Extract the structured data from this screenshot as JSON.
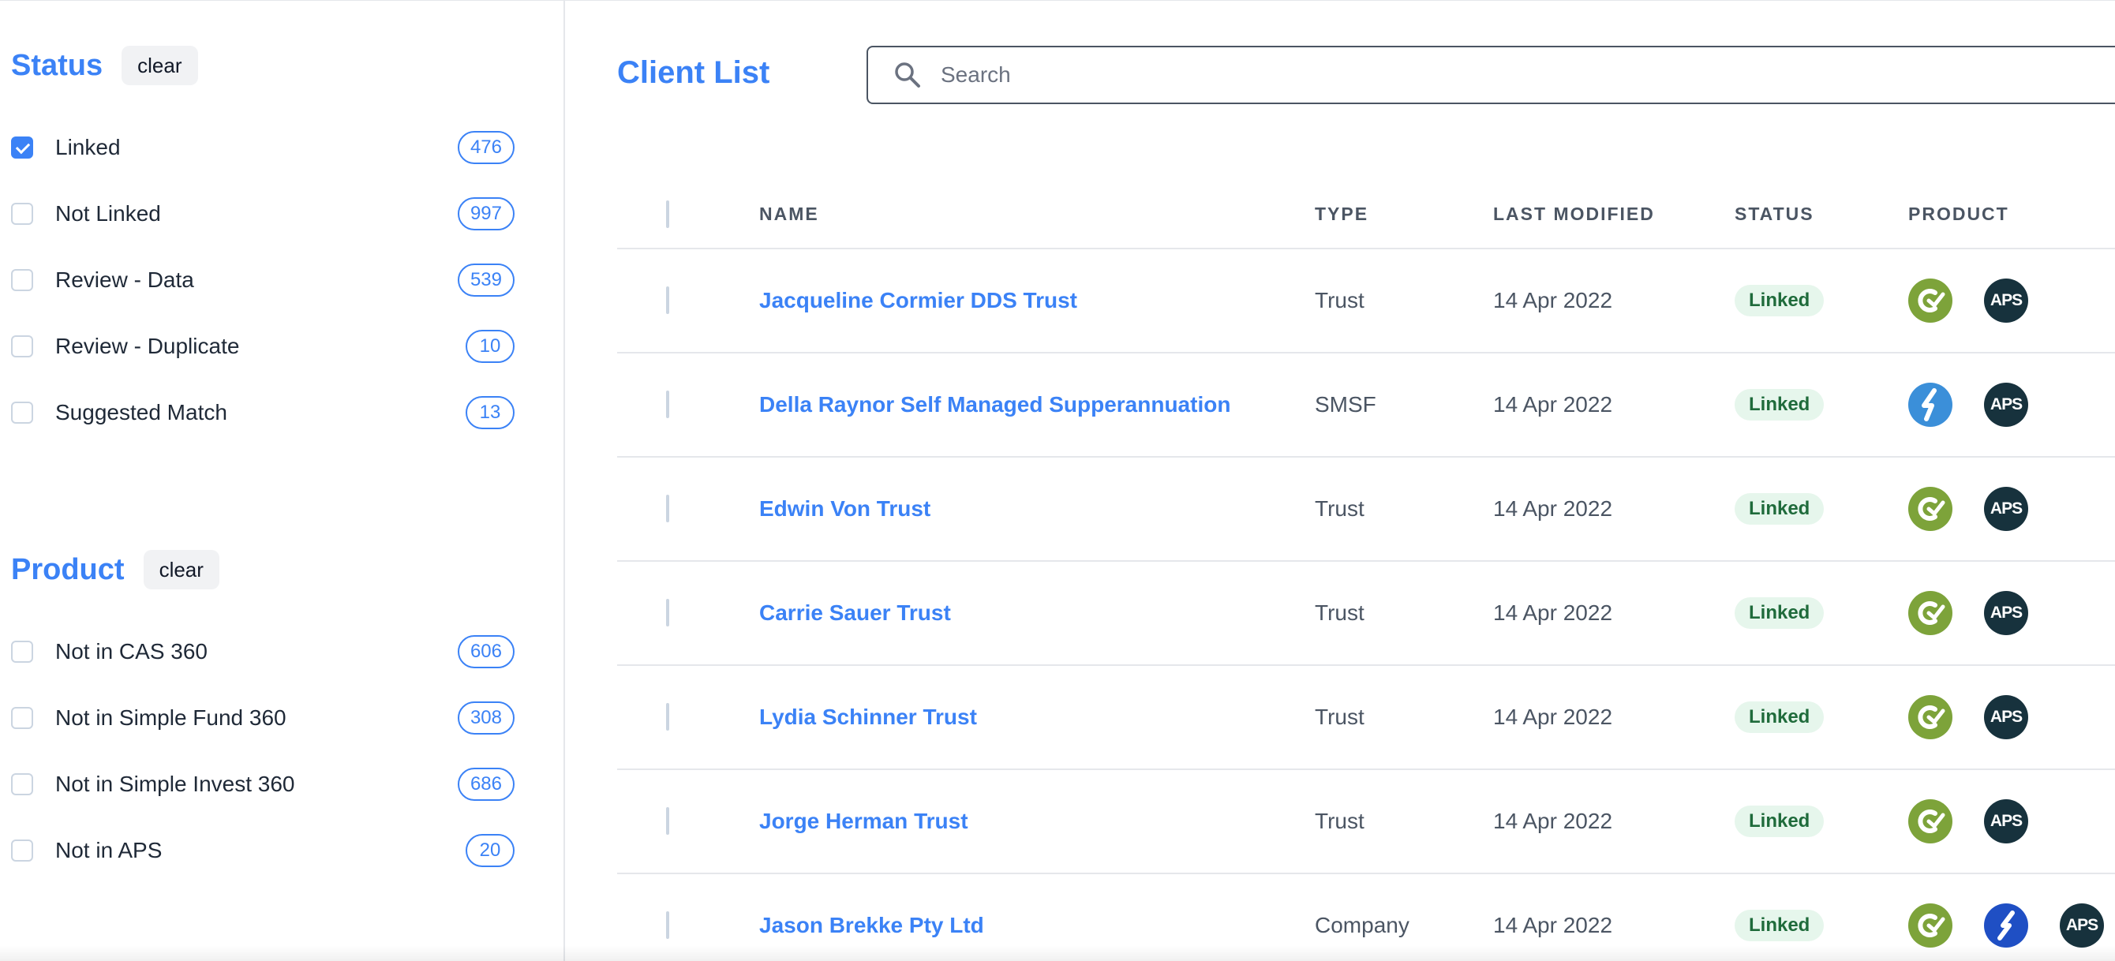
{
  "sidebar": {
    "status": {
      "title": "Status",
      "clear_label": "clear",
      "filters": [
        {
          "label": "Linked",
          "count": "476",
          "checked": true
        },
        {
          "label": "Not Linked",
          "count": "997",
          "checked": false
        },
        {
          "label": "Review - Data",
          "count": "539",
          "checked": false
        },
        {
          "label": "Review - Duplicate",
          "count": "10",
          "checked": false
        },
        {
          "label": "Suggested Match",
          "count": "13",
          "checked": false
        }
      ]
    },
    "product": {
      "title": "Product",
      "clear_label": "clear",
      "filters": [
        {
          "label": "Not in CAS 360",
          "count": "606",
          "checked": false
        },
        {
          "label": "Not in Simple Fund 360",
          "count": "308",
          "checked": false
        },
        {
          "label": "Not in Simple Invest 360",
          "count": "686",
          "checked": false
        },
        {
          "label": "Not in APS",
          "count": "20",
          "checked": false
        }
      ]
    }
  },
  "main": {
    "title": "Client List",
    "search": {
      "placeholder": "Search",
      "value": ""
    },
    "columns": [
      "NAME",
      "TYPE",
      "LAST MODIFIED",
      "STATUS",
      "PRODUCT"
    ],
    "rows": [
      {
        "name": "Jacqueline Cormier DDS Trust",
        "type": "Trust",
        "modified": "14 Apr 2022",
        "status": "Linked",
        "products": [
          "cas-360-icon",
          "aps-icon"
        ]
      },
      {
        "name": "Della Raynor Self Managed Supperannuation",
        "type": "SMSF",
        "modified": "14 Apr 2022",
        "status": "Linked",
        "products": [
          "simple-fund-360-icon",
          "aps-icon"
        ]
      },
      {
        "name": "Edwin Von Trust",
        "type": "Trust",
        "modified": "14 Apr 2022",
        "status": "Linked",
        "products": [
          "cas-360-icon",
          "aps-icon"
        ]
      },
      {
        "name": "Carrie Sauer Trust",
        "type": "Trust",
        "modified": "14 Apr 2022",
        "status": "Linked",
        "products": [
          "cas-360-icon",
          "aps-icon"
        ]
      },
      {
        "name": "Lydia Schinner Trust",
        "type": "Trust",
        "modified": "14 Apr 2022",
        "status": "Linked",
        "products": [
          "cas-360-icon",
          "aps-icon"
        ]
      },
      {
        "name": "Jorge Herman Trust",
        "type": "Trust",
        "modified": "14 Apr 2022",
        "status": "Linked",
        "products": [
          "cas-360-icon",
          "aps-icon"
        ]
      },
      {
        "name": "Jason Brekke Pty Ltd",
        "type": "Company",
        "modified": "14 Apr 2022",
        "status": "Linked",
        "products": [
          "cas-360-icon",
          "simple-invest-360-icon",
          "aps-icon"
        ]
      }
    ],
    "product_icon_text": {
      "aps": "APS"
    }
  },
  "colors": {
    "accent": "#3b82f6",
    "linked_badge_bg": "#e6f6ec",
    "linked_badge_text": "#1f6b3b",
    "cas_green": "#7da33a",
    "aps_dark": "#17323d",
    "simple_fund_blue": "#3b8fd9",
    "simple_invest_blue": "#1f4fc4"
  }
}
